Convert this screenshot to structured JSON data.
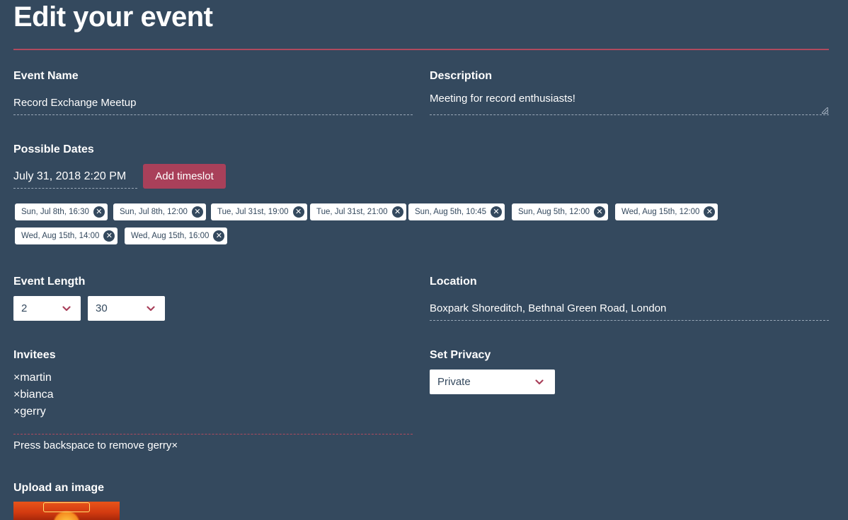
{
  "page": {
    "title": "Edit your event"
  },
  "event_name": {
    "label": "Event Name",
    "value": "Record Exchange Meetup"
  },
  "description": {
    "label": "Description",
    "value": "Meeting for record enthusiasts!"
  },
  "possible_dates": {
    "label": "Possible Dates",
    "picker_value": "July 31, 2018 2:20 PM",
    "add_button": "Add timeslot",
    "chips": [
      "Sun, Jul 8th, 16:30",
      "Sun, Jul 8th, 12:00",
      "Tue, Jul 31st, 19:00",
      "Tue, Jul 31st, 21:00",
      "Sun, Aug 5th, 10:45",
      "Sun, Aug 5th, 12:00",
      "Wed, Aug 15th, 12:00",
      "Wed, Aug 15th, 14:00",
      "Wed, Aug 15th, 16:00"
    ],
    "chip_close_glyph": "✕"
  },
  "event_length": {
    "label": "Event Length",
    "hours": "2",
    "minutes": "30"
  },
  "location": {
    "label": "Location",
    "value": "Boxpark Shoreditch, Bethnal Green Road, London"
  },
  "invitees": {
    "label": "Invitees",
    "list": [
      "×martin",
      "×bianca",
      "×gerry"
    ],
    "hint": "Press backspace to remove gerry×"
  },
  "privacy": {
    "label": "Set Privacy",
    "value": "Private"
  },
  "upload": {
    "label": "Upload an image"
  },
  "colors": {
    "background": "#34495e",
    "accent": "#a9405a",
    "chip_bg": "#ffffff",
    "text": "#ffffff"
  },
  "icons": {
    "chevron": "chevron-down-icon",
    "chip_close": "close-circle-icon"
  }
}
